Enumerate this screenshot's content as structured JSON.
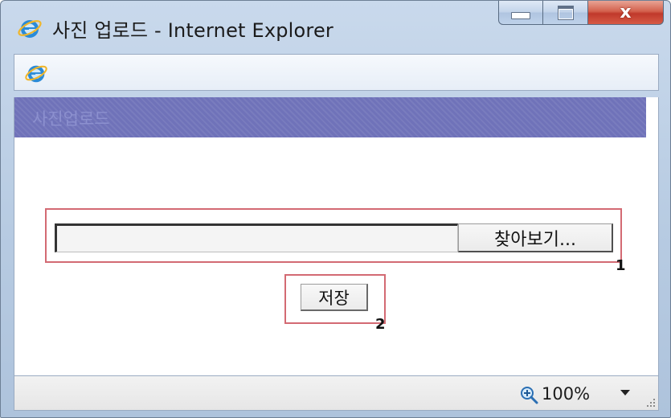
{
  "window": {
    "title": "사진 업로드 - Internet Explorer",
    "controls": {
      "minimize_icon": "minimize-icon",
      "maximize_icon": "maximize-icon",
      "close_glyph": "x"
    }
  },
  "header": {
    "title": "사진업로드",
    "color": "#6f72b9"
  },
  "upload": {
    "file_value": "",
    "browse_label": "찾아보기...",
    "save_label": "저장"
  },
  "annotations": {
    "label_1": "1",
    "label_2": "2",
    "color": "#d36a73"
  },
  "statusbar": {
    "zoom": "100%",
    "zoom_icon": "magnifier-plus-icon",
    "dropdown_icon": "triangle-down-icon"
  }
}
